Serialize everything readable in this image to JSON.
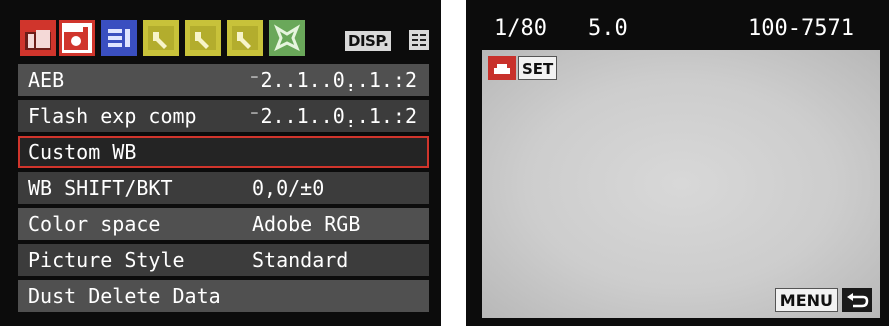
{
  "colors": {
    "accent_red": "#d0352c",
    "tab_blue": "#3a4fc0",
    "tab_yellow": "#c8c23a",
    "tab_green": "#6aa85a",
    "row_light": "#505050",
    "row_dark": "#3c3c3c"
  },
  "tabs": [
    {
      "name": "shooting-menu-1-icon",
      "color": "#d0352c",
      "active": false
    },
    {
      "name": "shooting-menu-2-icon",
      "color": "#d0352c",
      "active": true
    },
    {
      "name": "playback-menu-icon",
      "color": "#3a4fc0",
      "active": false
    },
    {
      "name": "setup-menu-1-icon",
      "color": "#c8c23a",
      "active": false
    },
    {
      "name": "setup-menu-2-icon",
      "color": "#c8c23a",
      "active": false
    },
    {
      "name": "setup-menu-3-icon",
      "color": "#c8c23a",
      "active": false
    },
    {
      "name": "my-menu-icon",
      "color": "#6aa85a",
      "active": false
    }
  ],
  "disp_label": "DISP.",
  "menu": {
    "rows": [
      {
        "label": "AEB",
        "value": "⁻2..1..0̣..1.:2"
      },
      {
        "label": "Flash exp comp",
        "value": "⁻2..1..0̣..1.:2"
      },
      {
        "label": "Custom WB",
        "value": ""
      },
      {
        "label": "WB SHIFT/BKT",
        "value": "0,0/±0"
      },
      {
        "label": "Color space",
        "value": "Adobe RGB"
      },
      {
        "label": "Picture Style",
        "value": "Standard"
      },
      {
        "label": "Dust Delete Data",
        "value": ""
      }
    ]
  },
  "viewer": {
    "shutter": "1/80",
    "aperture": "5.0",
    "file_number": "100-7571",
    "set_label": "SET",
    "menu_label": "MENU"
  }
}
